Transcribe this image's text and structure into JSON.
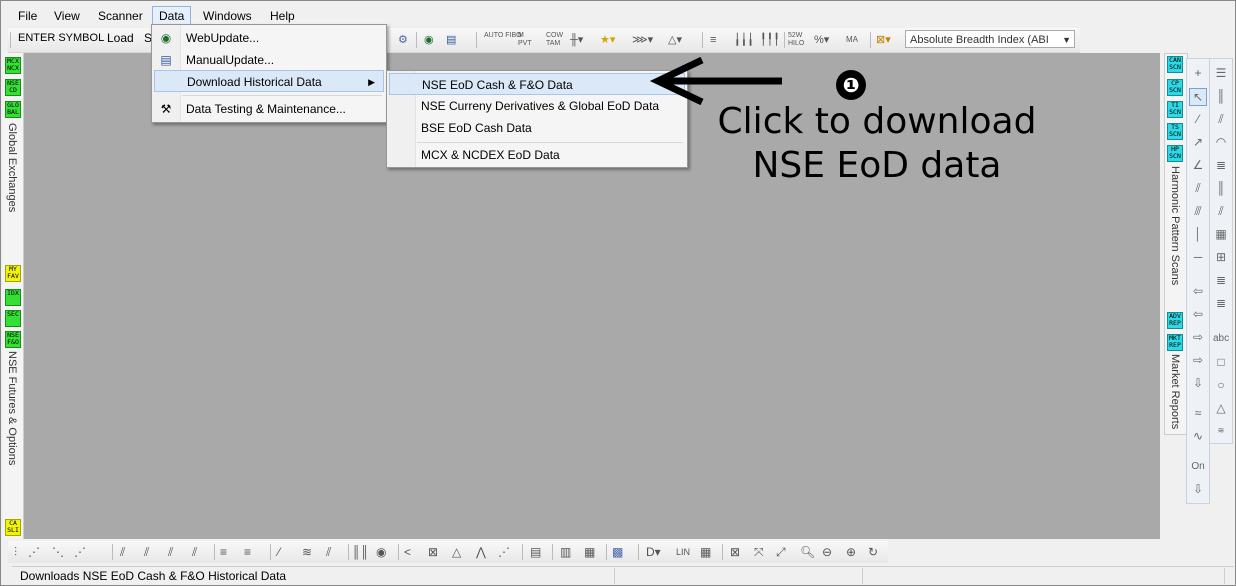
{
  "menubar": {
    "items": [
      "File",
      "View",
      "Scanner",
      "Data",
      "Windows",
      "Help"
    ],
    "active": "Data"
  },
  "toolbar": {
    "symbol_label": "ENTER SYMBOL",
    "load_label": "Load",
    "s_label": "S",
    "indicator_value": "Absolute Breadth Index (ABI",
    "icons": [
      "AUTO FIBO",
      "M PVT",
      "COW TAM",
      "52W HILO",
      "MA"
    ]
  },
  "data_menu": {
    "items": [
      {
        "label": "WebUpdate...",
        "icon": "globe-icon"
      },
      {
        "label": "ManualUpdate...",
        "icon": "database-icon"
      },
      {
        "label": "Download Historical Data",
        "icon": "",
        "has_submenu": true
      },
      {
        "label": "Data Testing & Maintenance...",
        "icon": "tools-icon"
      }
    ]
  },
  "submenu": {
    "items": [
      "NSE EoD Cash & F&O Data",
      "NSE Curreny Derivatives & Global EoD Data",
      "BSE EoD Cash Data",
      "MCX & NCDEX EoD Data"
    ]
  },
  "annotation": {
    "step": "❶",
    "line1": "Click to download",
    "line2": "NSE EoD data"
  },
  "left_panel": {
    "badges_top": [
      "MCX NCX",
      "NSE CD",
      "GLO BAL"
    ],
    "label_top": "Global Exchanges",
    "badges_mid": [
      "MY FAV",
      "IDX",
      "SEC",
      "NSE F&O"
    ],
    "label_mid": "NSE Futures & Options",
    "badge_bottom": "CA SLI"
  },
  "right_panel": {
    "badges_top": [
      "CAN SCN",
      "CP SCN",
      "TI SCN",
      "TS SCN",
      "HP SCN"
    ],
    "label_top": "Harmonic Pattern Scans",
    "badges_bottom": [
      "ADV REP",
      "MKT REP"
    ],
    "label_bottom": "Market Reports",
    "on_label": "On",
    "abc_label": "abc"
  },
  "bottom_toolbar": {
    "lin_label": "LIN"
  },
  "statusbar": {
    "text": "Downloads NSE EoD Cash & F&O Historical Data"
  }
}
